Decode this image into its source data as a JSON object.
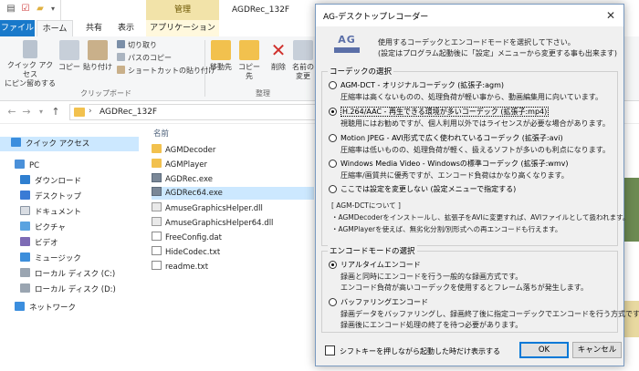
{
  "explorer": {
    "window_title": "AGDRec_132F",
    "context_tab": "管理",
    "tabs": [
      "ファイル",
      "ホーム",
      "共有",
      "表示",
      "アプリケーション ツール"
    ],
    "ribbon": {
      "pin_label": "クイック アクセス\nにピン留めする",
      "copy_label": "コピー",
      "paste_label": "貼り付け",
      "cut_label": "切り取り",
      "copy_path_label": "パスのコピー",
      "paste_shortcut_label": "ショートカットの貼り付け",
      "clipboard_group": "クリップボード",
      "move_label": "移動先",
      "copyto_label": "コピー先",
      "delete_label": "削除",
      "rename_label": "名前の\n変更",
      "organize_group": "整理"
    },
    "address": {
      "separator": "›",
      "path": "AGDRec_132F"
    },
    "nav": {
      "quick_access": "クイック アクセス",
      "pc": "PC",
      "items": [
        "ダウンロード",
        "デスクトップ",
        "ドキュメント",
        "ピクチャ",
        "ビデオ",
        "ミュージック",
        "ローカル ディスク (C:)",
        "ローカル ディスク (D:)"
      ],
      "network": "ネットワーク"
    },
    "column_header": "名前",
    "files": [
      {
        "name": "AGMDecoder",
        "type": "folder"
      },
      {
        "name": "AGMPlayer",
        "type": "folder"
      },
      {
        "name": "AGDRec.exe",
        "type": "exe"
      },
      {
        "name": "AGDRec64.exe",
        "type": "exe"
      },
      {
        "name": "AmuseGraphicsHelper.dll",
        "type": "dll"
      },
      {
        "name": "AmuseGraphicsHelper64.dll",
        "type": "dll"
      },
      {
        "name": "FreeConfig.dat",
        "type": "txt"
      },
      {
        "name": "HideCodec.txt",
        "type": "txt"
      },
      {
        "name": "readme.txt",
        "type": "txt"
      }
    ]
  },
  "dialog": {
    "title": "AG-デスクトップレコーダー",
    "close": "✕",
    "logo": "AG",
    "intro_line1": "使用するコーデックとエンコードモードを選択して下さい。",
    "intro_line2": "(設定はプログラム起動後に「設定」メニューから変更する事も出来ます)",
    "codec_group": "コーデックの選択",
    "codecs": [
      {
        "label": "AGM-DCT - オリジナルコーデック (拡張子:agm)",
        "desc": "圧縮率は高くないものの、処理負荷が軽い事から、動画編集用に向いています。",
        "selected": false
      },
      {
        "label": "H.264/AAC - 再生できる環境が多いコーデック (拡張子:mp4)",
        "desc": "視聴用にはお勧めですが、個人利用以外ではライセンスが必要な場合があります。",
        "selected": true
      },
      {
        "label": "Motion JPEG - AVI形式で広く使われているコーデック (拡張子:avi)",
        "desc": "圧縮率は低いものの、処理負荷が軽く、扱えるソフトが多いのも利点になります。",
        "selected": false
      },
      {
        "label": "Windows Media Video - Windowsの標準コーデック (拡張子:wmv)",
        "desc": "圧縮率/画質共に優秀ですが、エンコード負荷はかなり高くなります。",
        "selected": false
      },
      {
        "label": "ここでは設定を変更しない (設定メニューで指定する)",
        "desc": "",
        "selected": false
      }
    ],
    "notes": [
      "[ AGM-DCTについて ]",
      "・AGMDecoderをインストールし、拡張子をAVIに変更すれば、AVIファイルとして扱われます。",
      "・AGMPlayerを使えば、無劣化分割/別形式への再エンコードも行えます。"
    ],
    "mode_group": "エンコードモードの選択",
    "modes": [
      {
        "label": "リアルタイムエンコード",
        "desc1": "録画と同時にエンコードを行う一般的な録画方式です。",
        "desc2": "エンコード負荷が高いコーデックを使用するとフレーム落ちが発生します。",
        "selected": true
      },
      {
        "label": "バッファリングエンコード",
        "desc1": "録画データをバッファリングし、録画終了後に指定コーデックでエンコードを行う方式です。",
        "desc2": "録画後にエンコード処理の終了を待つ必要があります。",
        "selected": false
      }
    ],
    "checkbox_label": "シフトキーを押しながら起動した時だけ表示する",
    "checkbox_checked": false,
    "ok": "OK",
    "cancel": "キャンセル"
  }
}
